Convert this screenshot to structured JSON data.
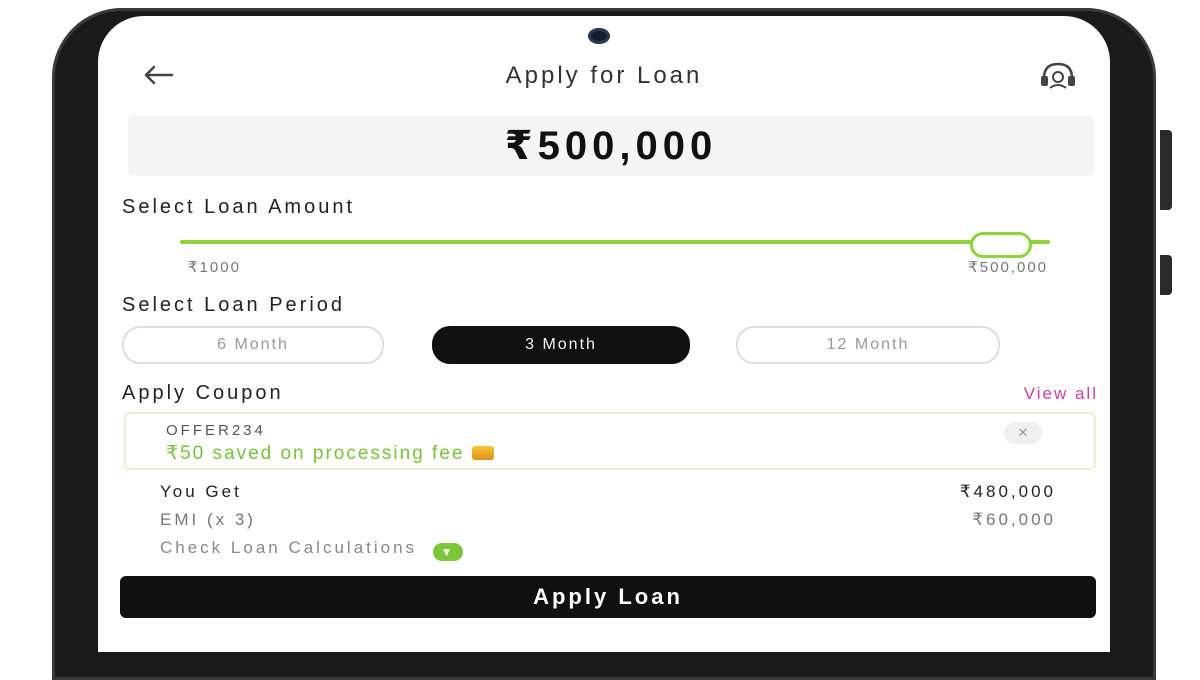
{
  "header": {
    "title": "Apply for Loan",
    "back_icon": "arrow-left-icon",
    "support_icon": "support-agent-icon"
  },
  "amount": {
    "display": "₹500,000"
  },
  "loan_amount": {
    "label": "Select Loan Amount",
    "min_label": "₹1000",
    "max_label": "₹500,000",
    "slider_fraction": 1.0
  },
  "loan_period": {
    "label": "Select Loan Period",
    "options": [
      {
        "label": "6 Month",
        "selected": false
      },
      {
        "label": "3 Month",
        "selected": true
      },
      {
        "label": "12 Month",
        "selected": false
      }
    ]
  },
  "coupon": {
    "label": "Apply Coupon",
    "view_all": "View all",
    "code": "OFFER234",
    "message": "₹50 saved on processing fee",
    "close_label": "✕"
  },
  "summary": {
    "you_get_label": "You Get",
    "you_get_value": "₹480,000",
    "emi_label": "EMI (x 3)",
    "emi_value": "₹60,000",
    "check_label": "Check Loan Calculations",
    "check_icon": "chevron-down-icon"
  },
  "footer": {
    "apply_label": "Apply Loan"
  },
  "colors": {
    "accent_green": "#8ed33a",
    "link_pink": "#cf3da4",
    "dark": "#101010"
  }
}
